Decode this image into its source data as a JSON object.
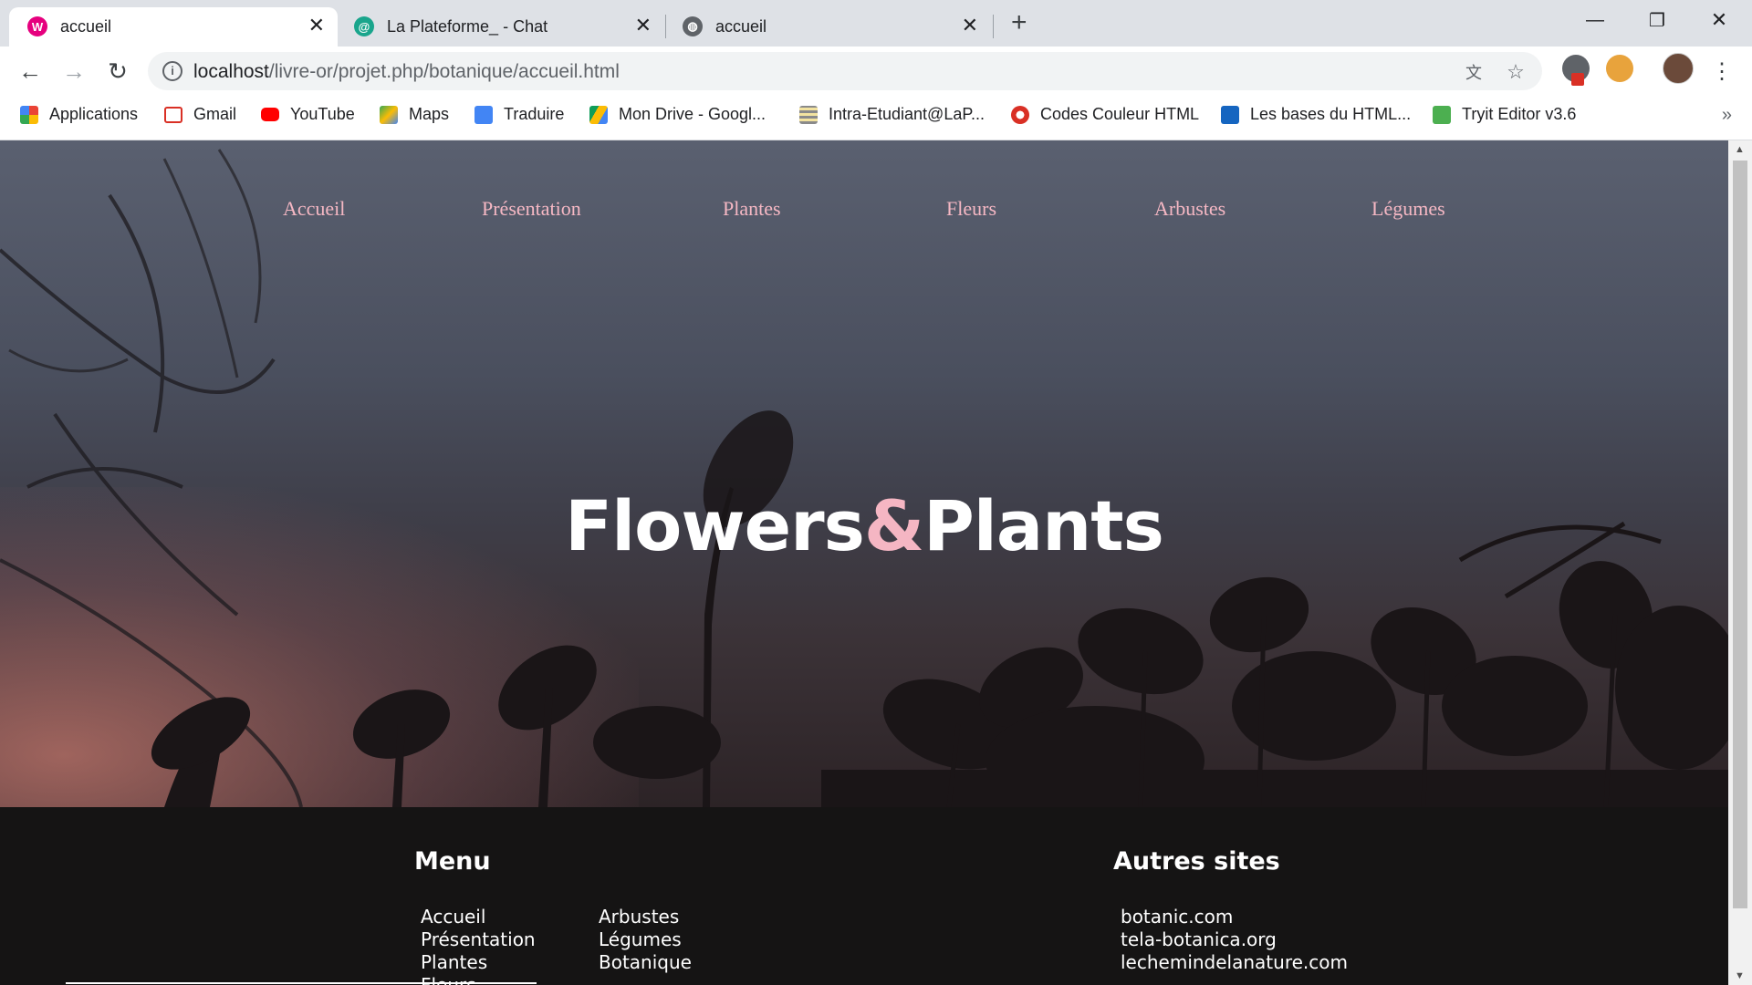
{
  "browser": {
    "tabs": [
      {
        "title": "accueil",
        "favicon": "wamp-icon"
      },
      {
        "title": "La Plateforme_ - Chat",
        "favicon": "chat-icon"
      },
      {
        "title": "accueil",
        "favicon": "globe-icon"
      }
    ],
    "url_host": "localhost",
    "url_path": "/livre-or/projet.php/botanique/accueil.html",
    "bookmarks": [
      "Applications",
      "Gmail",
      "YouTube",
      "Maps",
      "Traduire",
      "Mon Drive - Googl...",
      "Intra-Etudiant@LaP...",
      "Codes Couleur HTML",
      "Les bases du HTML...",
      "Tryit Editor v3.6"
    ],
    "bookmarks_overflow": "»"
  },
  "page": {
    "nav": [
      "Accueil",
      "Présentation",
      "Plantes",
      "Fleurs",
      "Arbustes",
      "Légumes"
    ],
    "hero": {
      "word1": "Flowers",
      "amp": "&",
      "word2": "Plants"
    },
    "footer": {
      "menu_title": "Menu",
      "menu_col1": [
        "Accueil",
        "Présentation",
        "Plantes",
        "Fleurs"
      ],
      "menu_col2": [
        "Arbustes",
        "Légumes",
        "Botanique"
      ],
      "sites_title": "Autres sites",
      "sites": [
        "botanic.com",
        "tela-botanica.org",
        "lechemindelanature.com"
      ]
    }
  },
  "colors": {
    "nav_text": "#f6b8c4",
    "ampersand": "#f5b6c3",
    "footer_bg": "#151414"
  }
}
